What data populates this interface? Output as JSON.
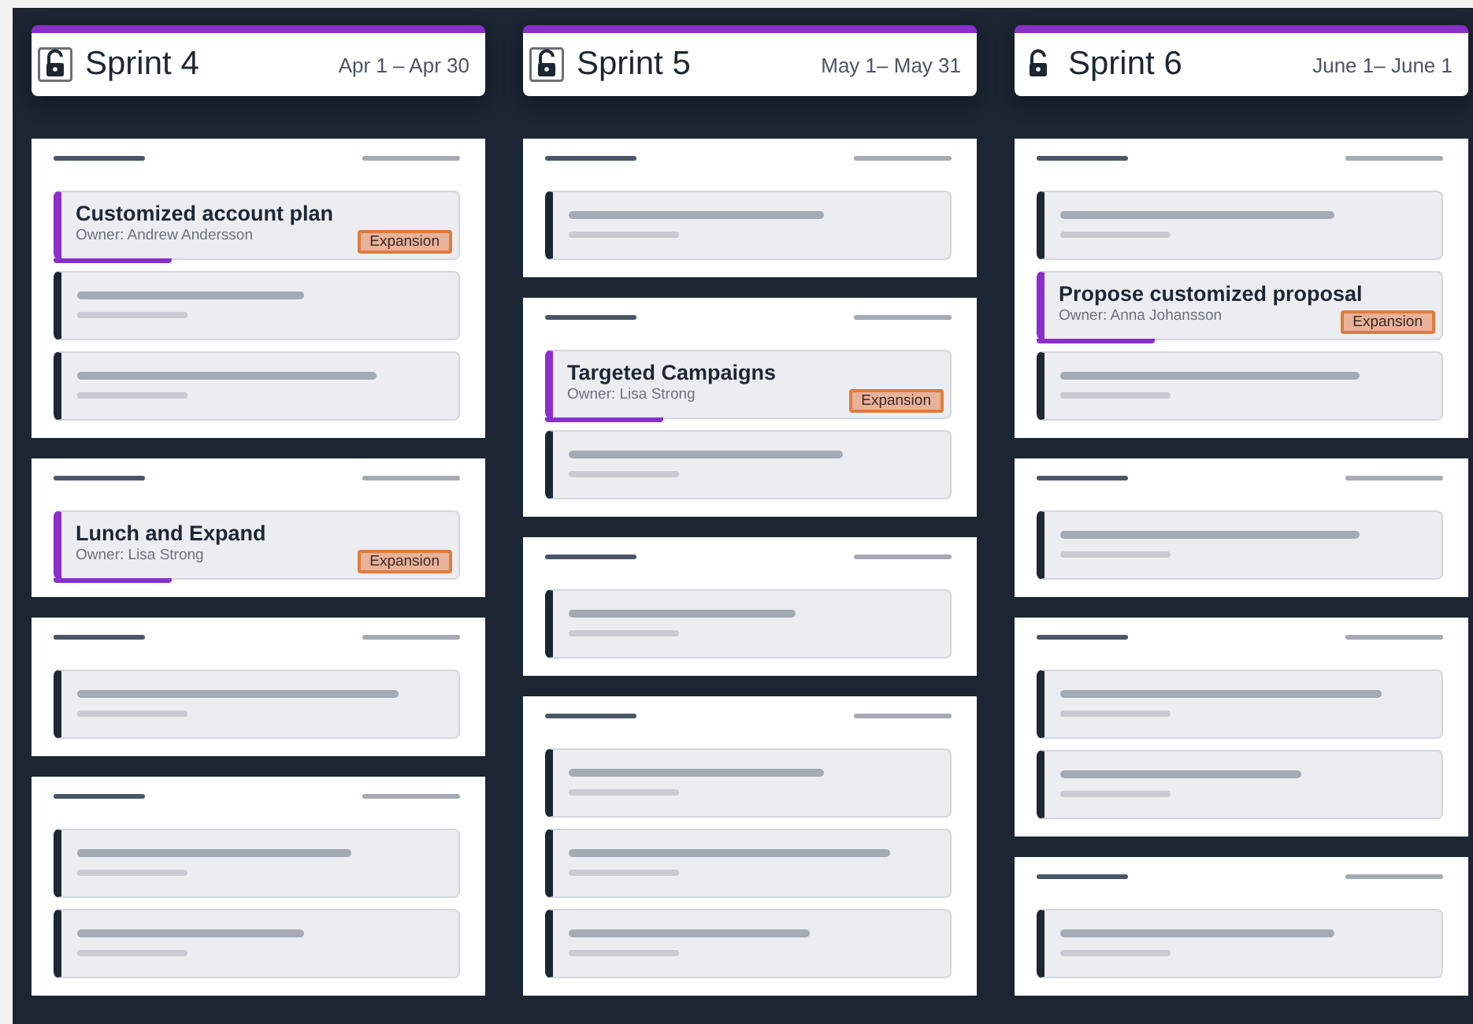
{
  "sprints": [
    {
      "title": "Sprint 4",
      "dates": "Apr 1 – Apr 30",
      "lock_framed": true,
      "groups": [
        {
          "cards": [
            {
              "kind": "task",
              "title": "Customized account plan",
              "owner": "Owner: Andrew Andersson",
              "tag": "Expansion"
            },
            {
              "kind": "placeholder"
            },
            {
              "kind": "placeholder"
            }
          ]
        },
        {
          "cards": [
            {
              "kind": "task",
              "title": "Lunch and Expand",
              "owner": "Owner: Lisa Strong",
              "tag": "Expansion"
            }
          ]
        },
        {
          "cards": [
            {
              "kind": "placeholder"
            }
          ]
        },
        {
          "cards": [
            {
              "kind": "placeholder"
            },
            {
              "kind": "placeholder"
            }
          ]
        }
      ]
    },
    {
      "title": "Sprint 5",
      "dates": "May 1– May 31",
      "lock_framed": true,
      "groups": [
        {
          "cards": [
            {
              "kind": "placeholder"
            }
          ]
        },
        {
          "cards": [
            {
              "kind": "task",
              "title": "Targeted Campaigns",
              "owner": "Owner: Lisa Strong",
              "tag": "Expansion"
            },
            {
              "kind": "placeholder"
            }
          ]
        },
        {
          "cards": [
            {
              "kind": "placeholder"
            }
          ]
        },
        {
          "cards": [
            {
              "kind": "placeholder"
            },
            {
              "kind": "placeholder"
            },
            {
              "kind": "placeholder"
            }
          ]
        }
      ]
    },
    {
      "title": "Sprint 6",
      "dates": "June 1– June 1",
      "lock_framed": false,
      "groups": [
        {
          "cards": [
            {
              "kind": "placeholder"
            },
            {
              "kind": "task",
              "title": "Propose customized proposal",
              "owner": "Owner: Anna Johansson",
              "tag": "Expansion"
            },
            {
              "kind": "placeholder"
            }
          ]
        },
        {
          "cards": [
            {
              "kind": "placeholder"
            }
          ]
        },
        {
          "cards": [
            {
              "kind": "placeholder"
            },
            {
              "kind": "placeholder"
            }
          ]
        },
        {
          "cards": [
            {
              "kind": "placeholder"
            }
          ]
        }
      ]
    }
  ]
}
